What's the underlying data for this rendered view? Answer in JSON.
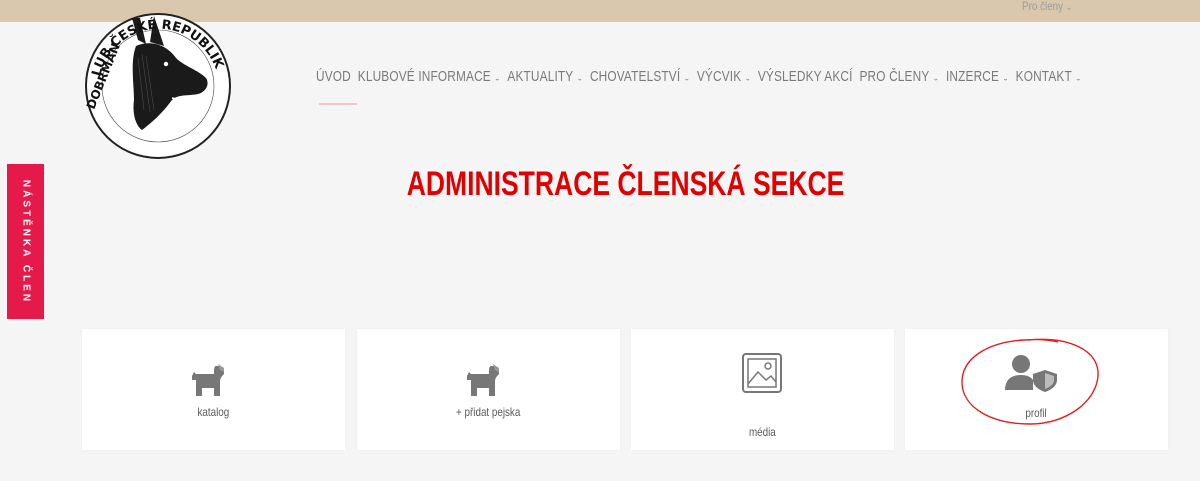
{
  "header": {
    "top_link_label": "Pro členy",
    "logo_text_top": "KLUB ČESKÉ REPUBLIKY",
    "logo_text_left": "DOBRMAN"
  },
  "nav": {
    "items": [
      {
        "label": "ÚVOD",
        "has_dropdown": false
      },
      {
        "label": "KLUBOVÉ INFORMACE",
        "has_dropdown": true
      },
      {
        "label": "AKTUALITY",
        "has_dropdown": true
      },
      {
        "label": "CHOVATELSTVÍ",
        "has_dropdown": true
      },
      {
        "label": "VÝCVIK",
        "has_dropdown": true
      },
      {
        "label": "VÝSLEDKY AKCÍ",
        "has_dropdown": false
      },
      {
        "label": "PRO ČLENY",
        "has_dropdown": true
      },
      {
        "label": "INZERCE",
        "has_dropdown": true
      },
      {
        "label": "KONTAKT",
        "has_dropdown": true
      }
    ],
    "chevron": "⌄"
  },
  "side_tab": {
    "label": "NÁSTĚNKA ČLEN"
  },
  "page": {
    "title": "ADMINISTRACE ČLENSKÁ SEKCE"
  },
  "cards": [
    {
      "label": "katalog",
      "icon": "dog-icon"
    },
    {
      "label": "+ přidat pejska",
      "icon": "dog-icon"
    },
    {
      "label": "média",
      "icon": "image-icon"
    },
    {
      "label": "profil",
      "icon": "user-shield-icon"
    }
  ],
  "colors": {
    "topbar": "#d9c8ae",
    "accent_red": "#e10000",
    "side_tab": "#e6194b",
    "icon_gray": "#777777",
    "annotation_red": "#e02020"
  }
}
